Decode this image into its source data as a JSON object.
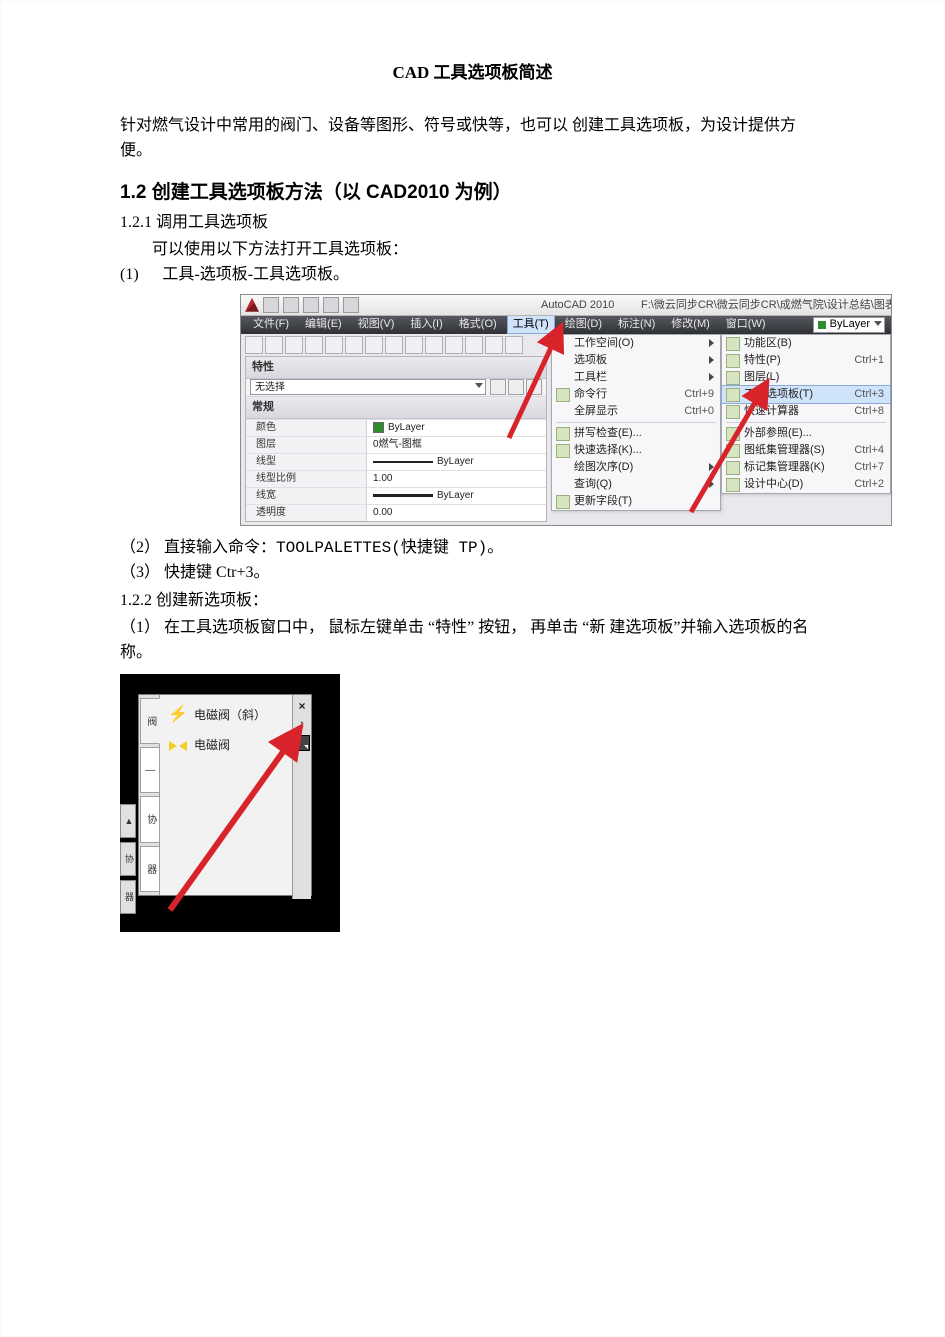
{
  "doc": {
    "title": "CAD 工具选项板简述",
    "intro": "针对燃气设计中常用的阀门、设备等图形、符号或快等，也可以 创建工具选项板，为设计提供方便。",
    "h12": "1.2 创建工具选项板方法（以 CAD2010 为例）",
    "s121_title": "1.2.1 调用工具选项板",
    "s121_lead": "可以使用以下方法打开工具选项板：",
    "s121_item1_num": "(1)",
    "s121_item1_text": "工具-选项板-工具选项板。",
    "s121_item2_num": "（2）",
    "s121_item2_text": "直接输入命令：TOOLPALETTES(快捷键 TP)。",
    "s121_item3_num": "（3）",
    "s121_item3_text": "快捷键 Ctr+3。",
    "s122_title": "1.2.2 创建新选项板：",
    "s122_item1_num": "（1）",
    "s122_item1_text": "在工具选项板窗口中， 鼠标左键单击 “特性” 按钮， 再单击 “新 建选项板”并输入选项板的名称。"
  },
  "shot1": {
    "appname": "AutoCAD 2010",
    "path": "F:\\微云同步CR\\微云同步CR\\成燃气院\\设计总结\\图表\\燃气",
    "menus": [
      "文件(F)",
      "编辑(E)",
      "视图(V)",
      "插入(I)",
      "格式(O)",
      "工具(T)",
      "绘图(D)",
      "标注(N)",
      "修改(M)",
      "窗口(W)"
    ],
    "active_menu_index": 5,
    "layer_box": "ByLayer",
    "props_title": "特性",
    "props_select": "无选择",
    "default_title": "常规",
    "grid": [
      {
        "label": "颜色",
        "value": "ByLayer",
        "swatch": "green"
      },
      {
        "label": "图层",
        "value": "0燃气-图框"
      },
      {
        "label": "线型",
        "value": "ByLayer",
        "line": "thin"
      },
      {
        "label": "线型比例",
        "value": "1.00"
      },
      {
        "label": "线宽",
        "value": "ByLayer",
        "line": "thick"
      },
      {
        "label": "透明度",
        "value": "0.00"
      }
    ],
    "drop": [
      {
        "label": "工作空间(O)",
        "chev": true
      },
      {
        "label": "选项板",
        "chev": true,
        "hover": true
      },
      {
        "label": "工具栏",
        "chev": true
      },
      {
        "label": "命令行",
        "shortcut": "Ctrl+9",
        "icon": true
      },
      {
        "label": "全屏显示",
        "shortcut": "Ctrl+0"
      },
      {
        "sep": true
      },
      {
        "label": "拼写检查(E)...",
        "icon": true
      },
      {
        "label": "快速选择(K)...",
        "icon": true
      },
      {
        "label": "绘图次序(D)",
        "chev": true
      },
      {
        "label": "查询(Q)",
        "chev": true
      },
      {
        "label": "更新字段(T)",
        "icon": true
      }
    ],
    "submenu": [
      {
        "label": "功能区(B)",
        "icon": true
      },
      {
        "label": "特性(P)",
        "shortcut": "Ctrl+1",
        "icon": true
      },
      {
        "label": "图层(L)",
        "icon": true
      },
      {
        "label": "工具选项板(T)",
        "shortcut": "Ctrl+3",
        "hl": true,
        "icon": true
      },
      {
        "label": "快速计算器",
        "shortcut": "Ctrl+8",
        "icon": true
      },
      {
        "sep": true
      },
      {
        "label": "外部参照(E)...",
        "icon": true
      },
      {
        "label": "图纸集管理器(S)",
        "shortcut": "Ctrl+4",
        "icon": true
      },
      {
        "label": "标记集管理器(K)",
        "shortcut": "Ctrl+7",
        "icon": true
      },
      {
        "label": "设计中心(D)",
        "shortcut": "Ctrl+2",
        "icon": true
      }
    ]
  },
  "shot2": {
    "tabs": [
      "阀",
      "—",
      "协",
      "器"
    ],
    "selected_tab_index": 0,
    "items": [
      {
        "label": "电磁阀（斜）",
        "icon": "valve-diag"
      },
      {
        "label": "电磁阀",
        "icon": "valve"
      }
    ],
    "close": "×",
    "pin": "↕",
    "left_tray": [
      "▲",
      "协",
      "器"
    ]
  }
}
